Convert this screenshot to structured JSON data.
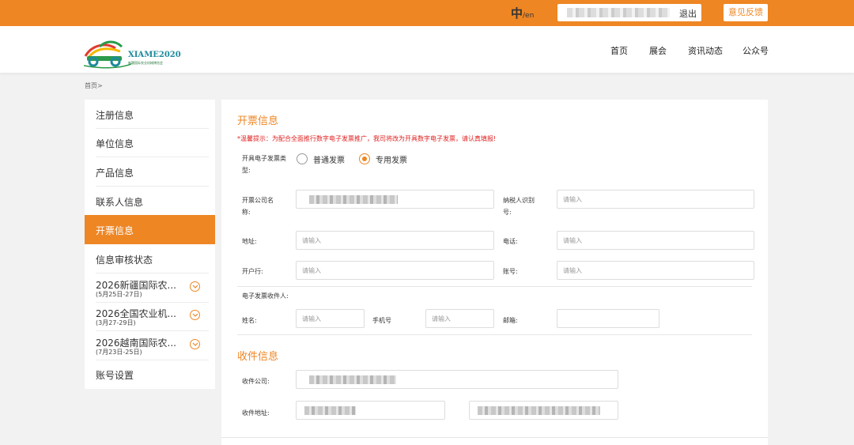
{
  "topbar": {
    "lang_zh": "中",
    "lang_en": "/en",
    "logout": "退出",
    "feedback": "意见反馈"
  },
  "header": {
    "logo_text": "XIAME2020",
    "logo_sub": "新疆国际农业机械博览会",
    "nav": [
      "首页",
      "展会",
      "资讯动态",
      "公众号"
    ]
  },
  "breadcrumb": "首页>",
  "sidebar": {
    "items": [
      "注册信息",
      "单位信息",
      "产品信息",
      "联系人信息",
      "开票信息",
      "信息审核状态"
    ],
    "expos": [
      {
        "name": "2026新疆国际农...",
        "date": "(5月25日-27日)"
      },
      {
        "name": "2026全国农业机...",
        "date": "(3月27-29日)"
      },
      {
        "name": "2026越南国际农...",
        "date": "(7月23日-25日)"
      }
    ],
    "account": "账号设置"
  },
  "invoice": {
    "title": "开票信息",
    "notice": "*温馨提示：为配合全面推行数字电子发票推广，我司将改为开具数字电子发票，请认真填报!",
    "type_label": "开具电子发票类型:",
    "type_options": [
      "普通发票",
      "专用发票"
    ],
    "selected_type": "专用发票",
    "company_label": "开票公司名称:",
    "taxid_label": "纳税人识别号:",
    "address_label": "地址:",
    "phone_label": "电话:",
    "bank_label": "开户行:",
    "account_label": "账号:",
    "recipient_heading": "电子发票收件人:",
    "name_label": "姓名:",
    "mobile_label": "手机号",
    "email_label": "邮箱:",
    "placeholder": "请输入"
  },
  "shipping": {
    "title": "收件信息",
    "company_label": "收件公司:",
    "address_label": "收件地址:"
  },
  "colors": {
    "accent": "#ee8624",
    "warning": "#e02020"
  }
}
